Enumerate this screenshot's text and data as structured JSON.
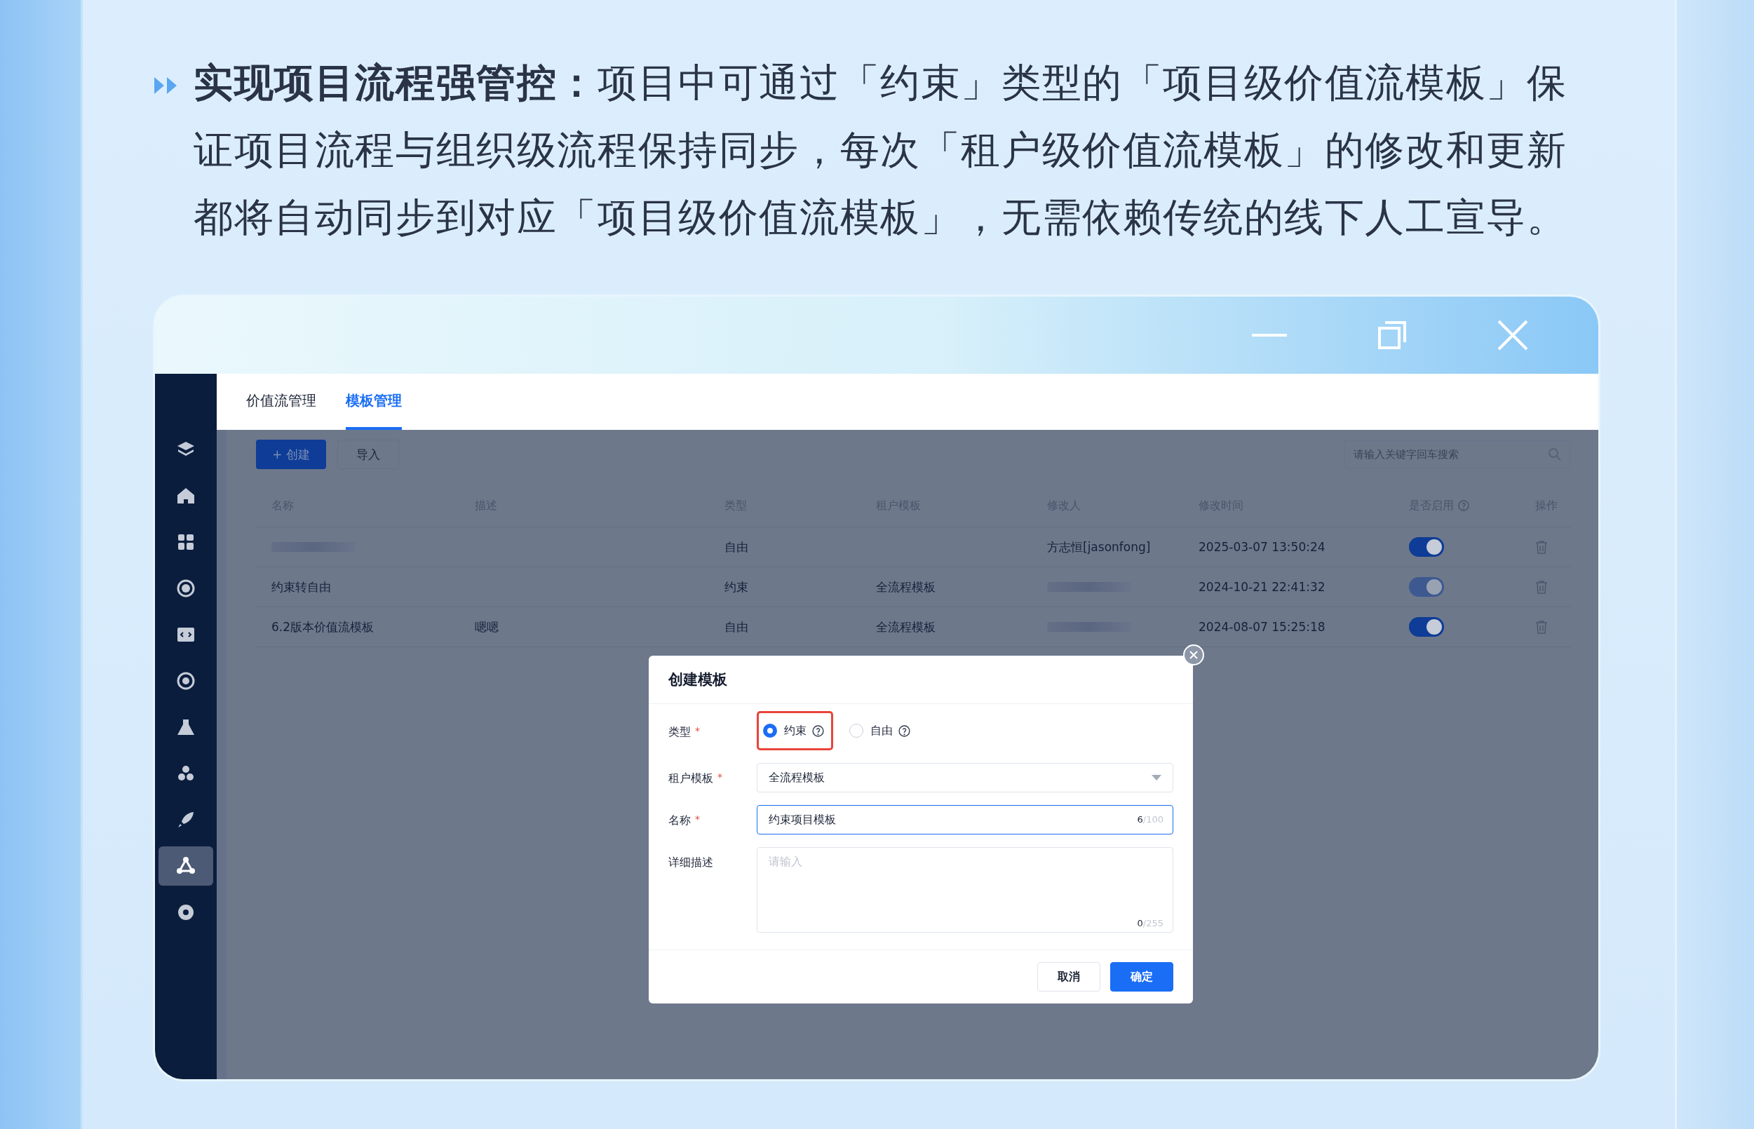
{
  "headline": {
    "text": "**实现项目流程强管控：**项目中可通过「约束」类型的「项目级价值流模板」保证项目流程与组织级流程保持同步，每次「租户级价值流模板」的修改和更新都将自动同步到对应「项目级价值流模板」，无需依赖传统的线下人工宣导。"
  },
  "sidebar": {
    "items": [
      {
        "selected": false
      },
      {
        "selected": false
      },
      {
        "selected": false
      },
      {
        "selected": false
      },
      {
        "selected": false
      },
      {
        "selected": false
      },
      {
        "selected": false
      },
      {
        "selected": false
      },
      {
        "selected": false
      },
      {
        "selected": true
      },
      {
        "selected": false
      }
    ]
  },
  "tabs": [
    {
      "label": "价值流管理",
      "selected": false
    },
    {
      "label": "模板管理",
      "selected": true
    }
  ],
  "toolbar": {
    "create_button": "+ 创建",
    "import_button": "导入",
    "search": {
      "placeholder": "请输入关键字回车搜索"
    }
  },
  "table": {
    "columns": [
      "名称",
      "描述",
      "类型",
      "租户模板",
      "修改人",
      "修改时间",
      "是否启用",
      "操作"
    ],
    "rows": [
      {
        "name": "",
        "description": "",
        "type": "自由",
        "tenant_template": "",
        "modifier": "方志恒[jasonfong]",
        "modified_time": "2025-03-07 13:50:24",
        "enabled": true,
        "disabled": false
      },
      {
        "name": "约束转自由",
        "description": "",
        "type": "约束",
        "tenant_template": "全流程模板",
        "modifier": "",
        "modified_time": "2024-10-21 22:41:32",
        "enabled": true,
        "disabled": true
      },
      {
        "name": "6.2版本价值流模板",
        "description": "嗯嗯",
        "type": "自由",
        "tenant_template": "全流程模板",
        "modifier": "",
        "modified_time": "2024-08-07 15:25:18",
        "enabled": true,
        "disabled": false
      }
    ]
  },
  "dialog": {
    "title": "创建模板",
    "type_field": {
      "label": "类型",
      "required_mark": "*",
      "options": [
        {
          "label": "约束",
          "selected": true,
          "highlighted": true
        },
        {
          "label": "自由",
          "selected": false,
          "highlighted": false
        }
      ]
    },
    "tenant_field": {
      "label": "租户模板",
      "required_mark": "*",
      "value": "全流程模板"
    },
    "name_field": {
      "label": "名称",
      "required_mark": "*",
      "value": "约束项目模板",
      "count": "6",
      "limit": "/100"
    },
    "description_field": {
      "label": "详细描述",
      "placeholder": "请输入",
      "count": "0",
      "limit": "/255"
    },
    "buttons": [
      {
        "label": "取消",
        "kind": "secondary"
      },
      {
        "label": "确定",
        "kind": "primary"
      }
    ]
  }
}
